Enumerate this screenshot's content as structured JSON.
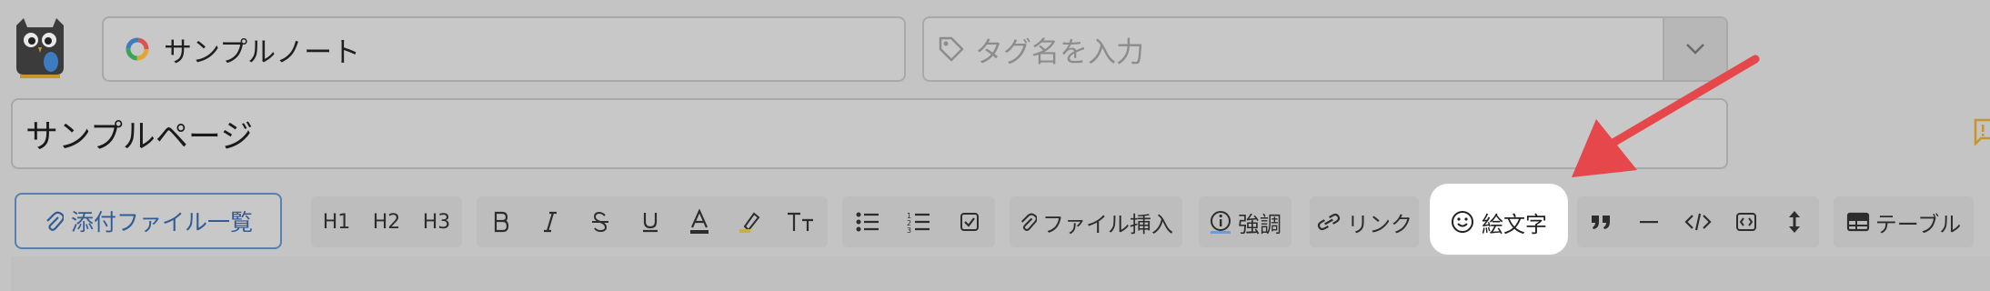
{
  "notebook": {
    "name": "サンプルノート",
    "icon": "notebook-ring-icon"
  },
  "tags": {
    "placeholder": "タグ名を入力",
    "icon": "tag-icon",
    "dropdown_icon": "chevron-down-icon"
  },
  "page": {
    "title": "サンプルページ"
  },
  "toolbar": {
    "attachments_label": "添付ファイル一覧",
    "h1": "H1",
    "h2": "H2",
    "h3": "H3",
    "file_insert_label": "ファイル挿入",
    "emphasis_label": "強調",
    "link_label": "リンク",
    "emoji_label": "絵文字",
    "table_label": "テーブル"
  },
  "colors": {
    "accent": "#315c95",
    "arrow": "#e5474b",
    "highlight": "#ffffff",
    "overlay": "#c4c4c4"
  }
}
